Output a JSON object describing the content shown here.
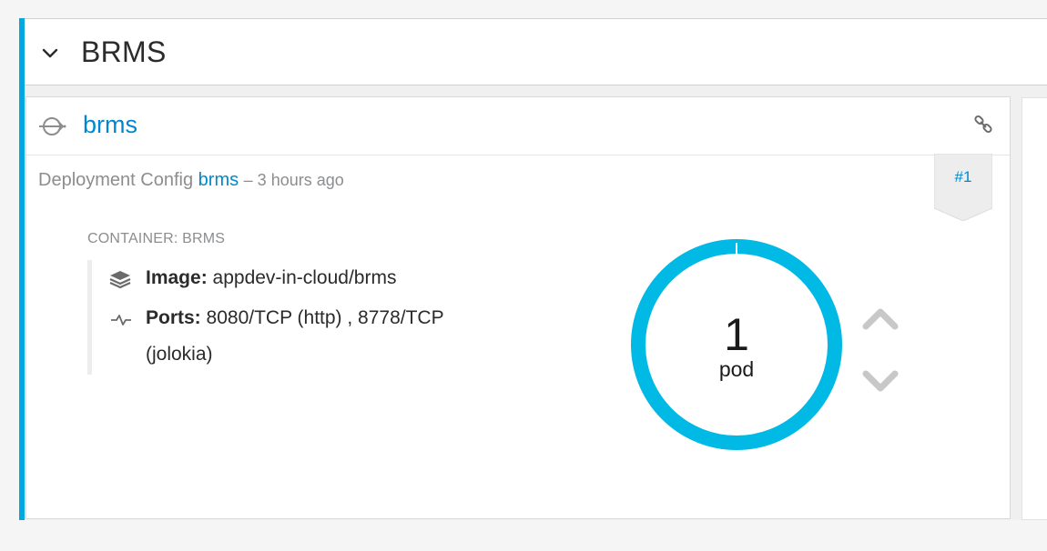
{
  "project": {
    "title": "BRMS"
  },
  "service": {
    "name": "brms",
    "deployment_prefix": "Deployment Config",
    "deployment_name": "brms",
    "deployment_age": "– 3 hours ago",
    "revision": "#1"
  },
  "container": {
    "label": "CONTAINER: BRMS",
    "image_label": "Image:",
    "image_value": "appdev-in-cloud/brms",
    "ports_label": "Ports:",
    "ports_value_line1": "8080/TCP (http) , 8778/TCP",
    "ports_value_line2": "(jolokia)"
  },
  "pods": {
    "count": "1",
    "unit": "pod"
  },
  "icons": {
    "toggle": "chevron-down-icon",
    "service": "service-icon",
    "link": "link-icon",
    "image": "layers-icon",
    "ports": "pulse-icon",
    "scale_up": "chevron-up-icon",
    "scale_down": "chevron-down-icon"
  },
  "colors": {
    "accent": "#00a8e1",
    "link": "#0088ce",
    "donut": "#00b9e4",
    "scale_arrows": "#c8c8c8"
  }
}
